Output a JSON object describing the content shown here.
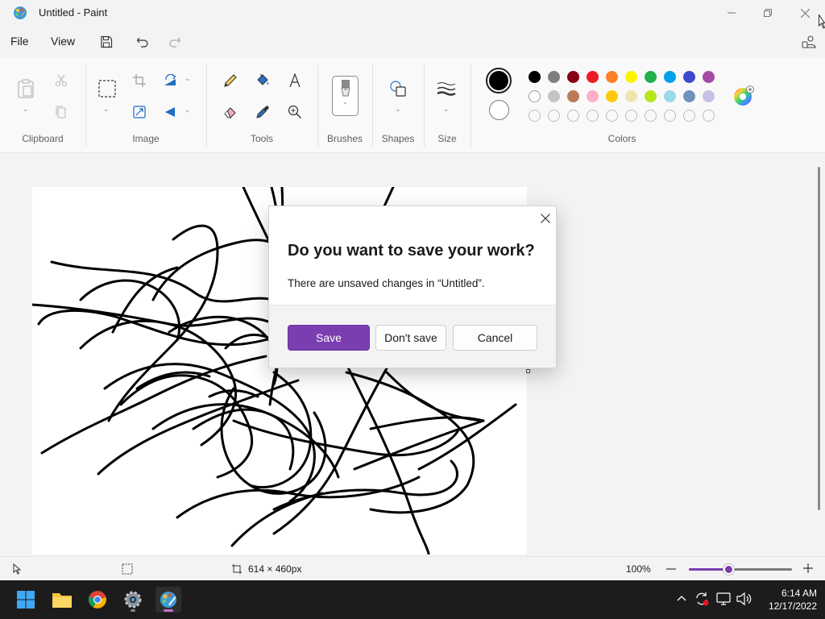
{
  "window": {
    "title": "Untitled - Paint"
  },
  "menu": {
    "file": "File",
    "view": "View"
  },
  "ribbon": {
    "groups": {
      "clipboard": "Clipboard",
      "image": "Image",
      "tools": "Tools",
      "brushes": "Brushes",
      "shapes": "Shapes",
      "size": "Size",
      "colors": "Colors"
    }
  },
  "colors": {
    "primary": "#000000",
    "secondary": "#ffffff",
    "accent": "#7a3eb0",
    "row1": [
      "#000000",
      "#7f7f7f",
      "#880015",
      "#ed1c24",
      "#ff7f27",
      "#fff200",
      "#22b14c",
      "#00a2e8",
      "#3f48cc",
      "#a349a4"
    ],
    "row2": [
      "#ffffff",
      "#c3c3c3",
      "#b97a57",
      "#ffaec9",
      "#ffc90e",
      "#efe4b0",
      "#b5e61d",
      "#99d9ea",
      "#7092be",
      "#c8bfe7"
    ]
  },
  "dialog": {
    "title": "Do you want to save your work?",
    "message": "There are unsaved changes in “Untitled”.",
    "save": "Save",
    "dont_save": "Don't save",
    "cancel": "Cancel"
  },
  "status": {
    "canvas_size": "614 × 460px",
    "zoom": "100%",
    "zoom_slider_fraction": 0.38
  },
  "taskbar": {
    "time": "6:14 AM",
    "date": "12/17/2022",
    "apps": [
      "start-icon",
      "file-explorer-icon",
      "chrome-icon",
      "settings-icon",
      "paint-icon"
    ]
  }
}
